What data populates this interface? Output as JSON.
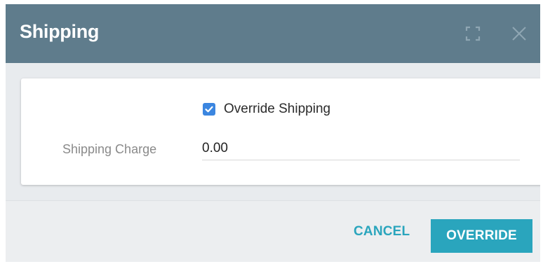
{
  "dialog": {
    "title": "Shipping",
    "header_icons": {
      "expand": "expand-icon",
      "close": "close-icon"
    }
  },
  "form": {
    "override_checkbox": {
      "label": "Override Shipping",
      "checked": true
    },
    "shipping_charge": {
      "label": "Shipping Charge",
      "value": "0.00"
    }
  },
  "footer": {
    "cancel_label": "CANCEL",
    "override_label": "OVERRIDE"
  },
  "colors": {
    "header_bg": "#5f7c8c",
    "accent": "#2aa5bd",
    "checkbox": "#3b86e0",
    "body_bg": "#e8ebee"
  }
}
